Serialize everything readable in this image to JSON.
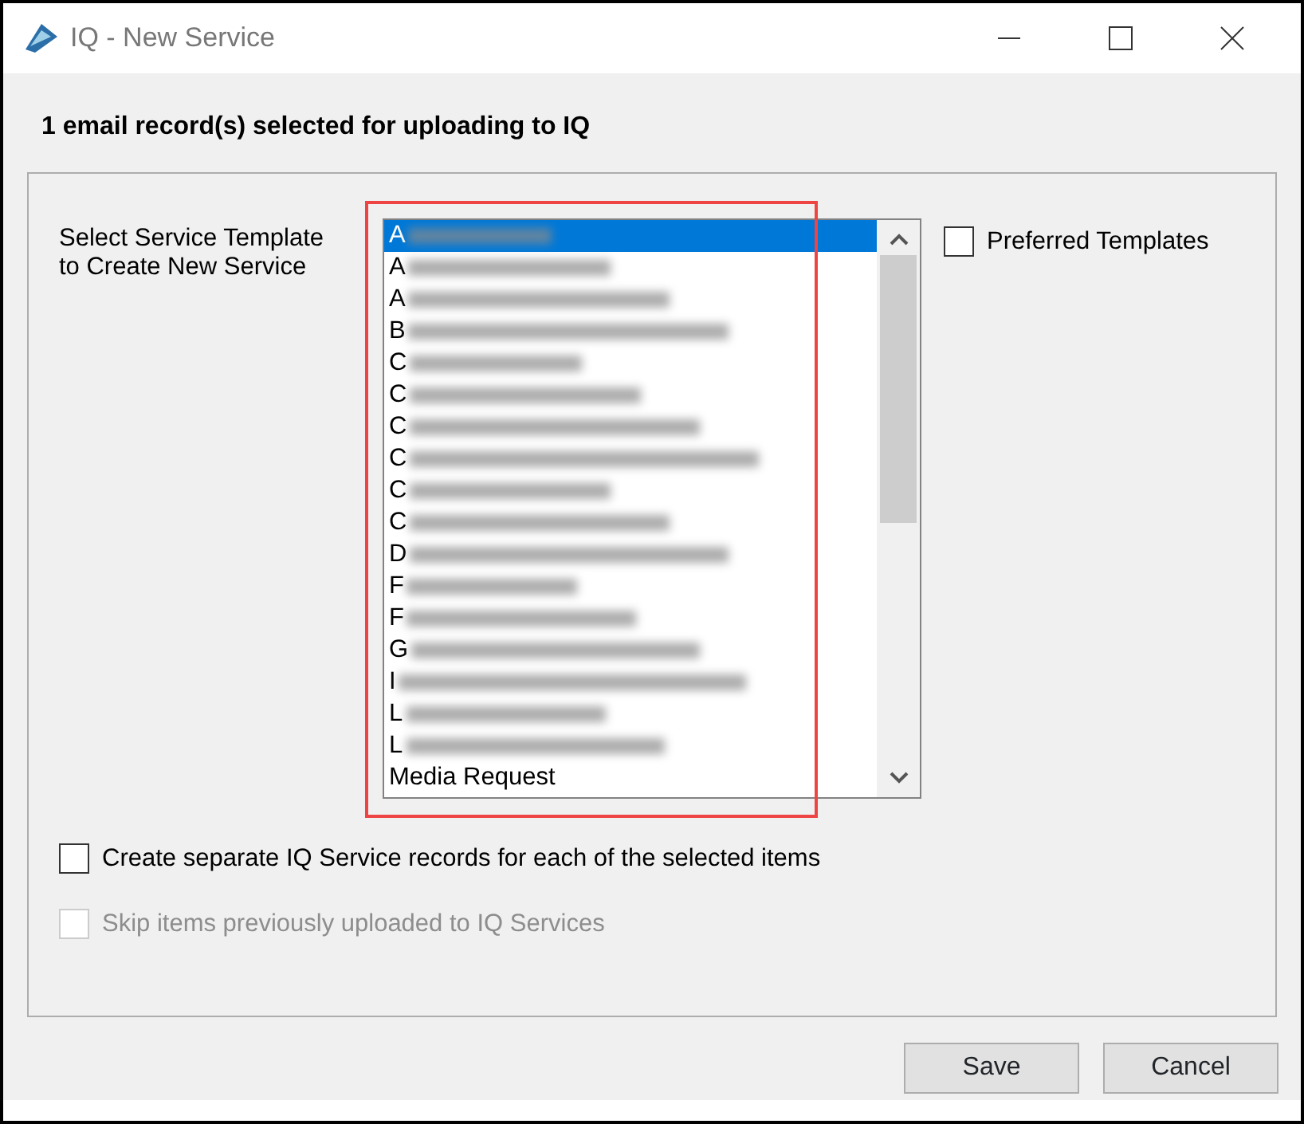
{
  "window": {
    "title": "IQ - New Service"
  },
  "header": "1 email record(s) selected for uploading to IQ",
  "template_label": "Select Service Template to Create New Service",
  "template_list": {
    "highlighted": true,
    "items": [
      {
        "text": "A",
        "blurred": true,
        "selected": true
      },
      {
        "text": "A",
        "blurred": true,
        "selected": false
      },
      {
        "text": "A",
        "blurred": true,
        "selected": false
      },
      {
        "text": "B",
        "blurred": true,
        "selected": false
      },
      {
        "text": "C",
        "blurred": true,
        "selected": false
      },
      {
        "text": "C",
        "blurred": true,
        "selected": false
      },
      {
        "text": "C",
        "blurred": true,
        "selected": false
      },
      {
        "text": "C",
        "blurred": true,
        "selected": false
      },
      {
        "text": "C",
        "blurred": true,
        "selected": false
      },
      {
        "text": "C",
        "blurred": true,
        "selected": false
      },
      {
        "text": "D",
        "blurred": true,
        "selected": false
      },
      {
        "text": "F",
        "blurred": true,
        "selected": false
      },
      {
        "text": "F",
        "blurred": true,
        "selected": false
      },
      {
        "text": "G",
        "blurred": true,
        "selected": false
      },
      {
        "text": "I",
        "blurred": true,
        "selected": false
      },
      {
        "text": "L",
        "blurred": true,
        "selected": false
      },
      {
        "text": "L",
        "blurred": true,
        "selected": false
      },
      {
        "text": "Media Request",
        "blurred": false,
        "selected": false
      }
    ]
  },
  "preferred": {
    "label": "Preferred Templates",
    "checked": false
  },
  "options": [
    {
      "label": "Create separate IQ Service records for each of the selected items",
      "checked": false,
      "disabled": false
    },
    {
      "label": "Skip items previously uploaded to IQ Services",
      "checked": false,
      "disabled": true
    }
  ],
  "buttons": [
    "Save",
    "Cancel"
  ]
}
